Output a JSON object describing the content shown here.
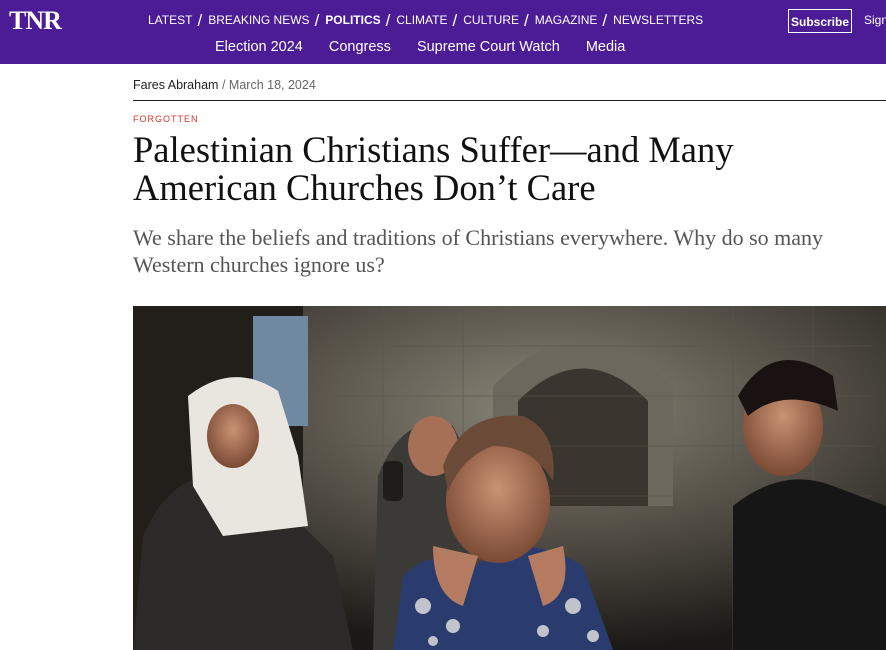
{
  "site": {
    "logo_text": "TNR"
  },
  "nav": {
    "primary": [
      {
        "label": "LATEST",
        "active": false
      },
      {
        "label": "BREAKING NEWS",
        "active": false
      },
      {
        "label": "POLITICS",
        "active": true
      },
      {
        "label": "CLIMATE",
        "active": false
      },
      {
        "label": "CULTURE",
        "active": false
      },
      {
        "label": "MAGAZINE",
        "active": false
      },
      {
        "label": "NEWSLETTERS",
        "active": false
      }
    ],
    "secondary": [
      "Election 2024",
      "Congress",
      "Supreme Court Watch",
      "Media"
    ],
    "subscribe_label": "Subscribe",
    "signin_label": "Sign"
  },
  "article": {
    "author": "Fares Abraham",
    "byline_separator": "/",
    "date": "March 18, 2024",
    "kicker": "FORGOTTEN",
    "headline": "Palestinian Christians Suffer—and Many American Churches Don’t Care",
    "dek": "We share the beliefs and traditions of Christians everywhere. Why do so many Western churches ignore us?"
  },
  "colors": {
    "brand": "#4c1c96",
    "kicker": "#d9342b"
  }
}
